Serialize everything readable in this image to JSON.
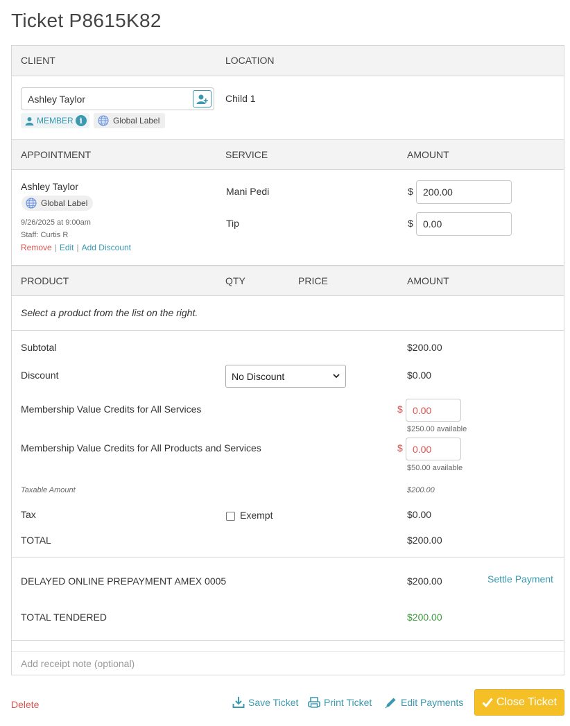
{
  "title": "Ticket P8615K82",
  "client_section": {
    "header_client": "CLIENT",
    "header_location": "LOCATION",
    "client_name": "Ashley Taylor",
    "member_label": "MEMBER",
    "global_label": "Global Label",
    "location_value": "Child 1"
  },
  "appointment_section": {
    "header_appointment": "APPOINTMENT",
    "header_service": "SERVICE",
    "header_amount": "AMOUNT",
    "client_name": "Ashley Taylor",
    "global_label": "Global Label",
    "datetime": "9/26/2025 at 9:00am",
    "staff": "Staff: Curtis R",
    "remove_label": "Remove",
    "edit_label": "Edit",
    "add_discount_label": "Add Discount",
    "service_name": "Mani Pedi",
    "service_amount": "200.00",
    "tip_label": "Tip",
    "tip_amount": "0.00",
    "currency": "$"
  },
  "product_section": {
    "header_product": "PRODUCT",
    "header_qty": "QTY",
    "header_price": "PRICE",
    "header_amount": "AMOUNT",
    "empty_message": "Select a product from the list on the right."
  },
  "totals": {
    "subtotal_label": "Subtotal",
    "subtotal_value": "$200.00",
    "discount_label": "Discount",
    "discount_select": "No Discount",
    "discount_value": "$0.00",
    "credits_services_label": "Membership Value Credits for All Services",
    "credits_services_value": "0.00",
    "credits_services_available": "$250.00 available",
    "credits_all_label": "Membership Value Credits for All Products and Services",
    "credits_all_value": "0.00",
    "credits_all_available": "$50.00 available",
    "taxable_label": "Taxable Amount",
    "taxable_value": "$200.00",
    "tax_label": "Tax",
    "exempt_label": "Exempt",
    "tax_value": "$0.00",
    "total_label": "TOTAL",
    "total_value": "$200.00"
  },
  "payments": {
    "payment_label": "DELAYED ONLINE PREPAYMENT AMEX 0005",
    "payment_value": "$200.00",
    "settle_label": "Settle Payment",
    "tendered_label": "TOTAL TENDERED",
    "tendered_value": "$200.00"
  },
  "receipt_note_placeholder": "Add receipt note (optional)",
  "footer": {
    "delete_label": "Delete",
    "save_label": "Save Ticket",
    "print_label": "Print Ticket",
    "edit_payments_label": "Edit Payments",
    "close_label": "Close Ticket"
  },
  "colors": {
    "accent": "#3a98b0",
    "danger": "#d9534f",
    "success": "#3c9a3c",
    "close_button": "#f5c026"
  }
}
